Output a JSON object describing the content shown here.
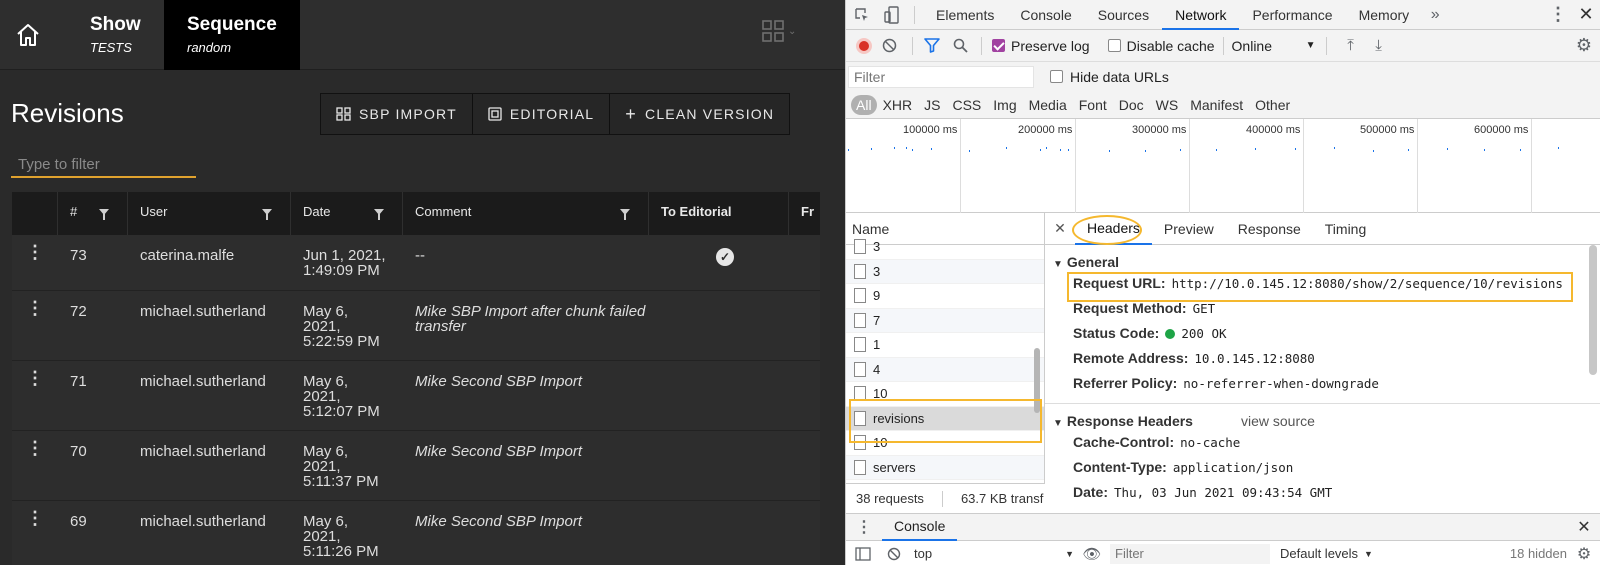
{
  "app": {
    "crumbs": [
      {
        "title": "Show",
        "subtitle": "TESTS"
      },
      {
        "title": "Sequence",
        "subtitle": "random"
      }
    ],
    "page_title": "Revisions",
    "toolbar": {
      "sbp_import": "SBP IMPORT",
      "editorial": "EDITORIAL",
      "clean_version": "CLEAN VERSION"
    },
    "filter_placeholder": "Type to filter",
    "table": {
      "headers": [
        "#",
        "User",
        "Date",
        "Comment",
        "To Editorial",
        "Fr"
      ],
      "rows": [
        {
          "num": "73",
          "user": "caterina.malfe",
          "date": [
            "Jun 1, 2021,",
            "1:49:09 PM"
          ],
          "comment": "--",
          "italic": false,
          "to_editorial": true
        },
        {
          "num": "72",
          "user": "michael.sutherland",
          "date": [
            "May 6,",
            "2021,",
            "5:22:59 PM"
          ],
          "comment": "Mike SBP Import after chunk failed transfer",
          "italic": true,
          "to_editorial": false
        },
        {
          "num": "71",
          "user": "michael.sutherland",
          "date": [
            "May 6,",
            "2021,",
            "5:12:07 PM"
          ],
          "comment": "Mike Second SBP Import",
          "italic": true,
          "to_editorial": false
        },
        {
          "num": "70",
          "user": "michael.sutherland",
          "date": [
            "May 6,",
            "2021,",
            "5:11:37 PM"
          ],
          "comment": "Mike Second SBP Import",
          "italic": true,
          "to_editorial": false
        },
        {
          "num": "69",
          "user": "michael.sutherland",
          "date": [
            "May 6,",
            "2021,",
            "5:11:26 PM"
          ],
          "comment": "Mike Second SBP Import",
          "italic": true,
          "to_editorial": false
        }
      ]
    }
  },
  "devtools": {
    "tabs": [
      "Elements",
      "Console",
      "Sources",
      "Network",
      "Performance",
      "Memory"
    ],
    "active_tab": "Network",
    "toolbar": {
      "preserve_log": "Preserve log",
      "preserve_log_checked": true,
      "disable_cache": "Disable cache",
      "throttling": "Online"
    },
    "filter_placeholder": "Filter",
    "hide_data_urls": "Hide data URLs",
    "types": [
      "All",
      "XHR",
      "JS",
      "CSS",
      "Img",
      "Media",
      "Font",
      "Doc",
      "WS",
      "Manifest",
      "Other"
    ],
    "timeline_labels": [
      "100000 ms",
      "200000 ms",
      "300000 ms",
      "400000 ms",
      "500000 ms",
      "600000 ms"
    ],
    "name_header": "Name",
    "requests": [
      "3",
      "3",
      "9",
      "7",
      "1",
      "4",
      "10",
      "revisions",
      "10",
      "servers"
    ],
    "selected_request": "revisions",
    "status_requests": "38 requests",
    "status_transfer": "63.7 KB transf",
    "detail_tabs": [
      "Headers",
      "Preview",
      "Response",
      "Timing"
    ],
    "general": {
      "title": "General",
      "request_url_key": "Request URL:",
      "request_url": "http://10.0.145.12:8080/show/2/sequence/10/revisions",
      "request_method_key": "Request Method:",
      "request_method": "GET",
      "status_code_key": "Status Code:",
      "status_code": "200 OK",
      "remote_address_key": "Remote Address:",
      "remote_address": "10.0.145.12:8080",
      "referrer_policy_key": "Referrer Policy:",
      "referrer_policy": "no-referrer-when-downgrade"
    },
    "response_headers": {
      "title": "Response Headers",
      "view_source": "view source",
      "cache_control_key": "Cache-Control:",
      "cache_control": "no-cache",
      "content_type_key": "Content-Type:",
      "content_type": "application/json",
      "date_key": "Date:",
      "date": "Thu, 03 Jun 2021 09:43:54 GMT"
    },
    "drawer": {
      "tab": "Console",
      "context": "top",
      "filter_placeholder": "Filter",
      "levels": "Default levels",
      "hidden": "18 hidden"
    }
  }
}
